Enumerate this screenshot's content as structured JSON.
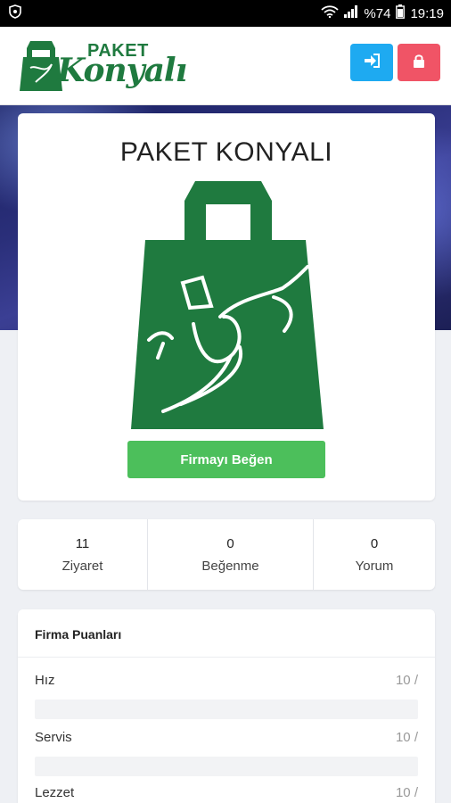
{
  "status_bar": {
    "battery_text": "%74",
    "time": "19:19"
  },
  "header": {
    "logo_top": "PAKET",
    "logo_bottom": "Konyalı",
    "brand_color": "#1f7a3f",
    "login_icon": "sign-in-icon",
    "lock_icon": "lock-icon",
    "login_color": "#1eaaf1",
    "lock_color": "#f05466"
  },
  "company": {
    "name": "PAKET KONYALI",
    "like_button": "Firmayı Beğen",
    "like_color": "#4cbf5b"
  },
  "stats": [
    {
      "value": "11",
      "label": "Ziyaret"
    },
    {
      "value": "0",
      "label": "Beğenme"
    },
    {
      "value": "0",
      "label": "Yorum"
    }
  ],
  "scores": {
    "title": "Firma Puanları",
    "rows": [
      {
        "name": "Hız",
        "value": "10 /"
      },
      {
        "name": "Servis",
        "value": "10 /"
      },
      {
        "name": "Lezzet",
        "value": "10 /"
      }
    ]
  }
}
